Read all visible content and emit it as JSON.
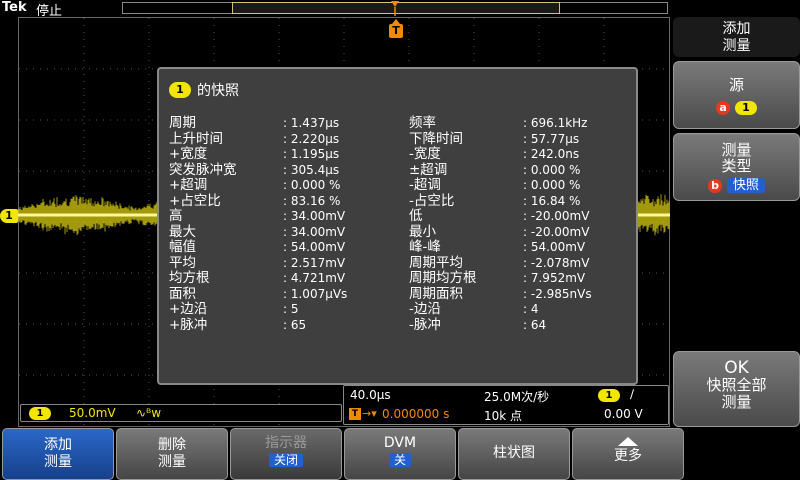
{
  "topbar": {
    "brand": "Tek",
    "status": "停止"
  },
  "markers": {
    "trigger": "T",
    "channel": "1"
  },
  "snapshot": {
    "badge": "1",
    "title": "的快照",
    "left": [
      {
        "label": "周期",
        "value": ": 1.437µs"
      },
      {
        "label": "上升时间",
        "value": ": 2.220µs"
      },
      {
        "label": "+宽度",
        "value": ": 1.195µs"
      },
      {
        "label": "突发脉冲宽",
        "value": ": 305.4µs"
      },
      {
        "label": "+超调",
        "value": ": 0.000 %"
      },
      {
        "label": "+占空比",
        "value": ": 83.16 %"
      },
      {
        "label": "高",
        "value": ": 34.00mV"
      },
      {
        "label": "最大",
        "value": ": 34.00mV"
      },
      {
        "label": "幅值",
        "value": ": 54.00mV"
      },
      {
        "label": "平均",
        "value": ": 2.517mV"
      },
      {
        "label": "均方根",
        "value": ": 4.721mV"
      },
      {
        "label": "面积",
        "value": ": 1.007µVs"
      },
      {
        "label": "+边沿",
        "value": ": 5"
      },
      {
        "label": "+脉冲",
        "value": ": 65"
      }
    ],
    "right": [
      {
        "label": "频率",
        "value": ": 696.1kHz"
      },
      {
        "label": "下降时间",
        "value": ": 57.77µs"
      },
      {
        "label": "-宽度",
        "value": ": 242.0ns"
      },
      {
        "label": "±超调",
        "value": ": 0.000 %"
      },
      {
        "label": "-超调",
        "value": ": 0.000 %"
      },
      {
        "label": "-占空比",
        "value": ": 16.84 %"
      },
      {
        "label": "低",
        "value": ": -20.00mV"
      },
      {
        "label": "最小",
        "value": ": -20.00mV"
      },
      {
        "label": "峰-峰",
        "value": ": 54.00mV"
      },
      {
        "label": "周期平均",
        "value": ": -2.078mV"
      },
      {
        "label": "周期均方根",
        "value": ": 7.952mV"
      },
      {
        "label": "周期面积",
        "value": ": -2.985nVs"
      },
      {
        "label": "-边沿",
        "value": ": 4"
      },
      {
        "label": "-脉冲",
        "value": ": 64"
      }
    ]
  },
  "channel_readout": {
    "badge": "1",
    "scale": "50.0mV",
    "coupling": "∿ᴮw"
  },
  "horizontal": {
    "scale": "40.0µs",
    "sample_rate": "25.0M次/秒",
    "trig_icon": "T",
    "arrow": "→▾",
    "delay": "0.000000 s",
    "record_length": "10k 点",
    "trig_channel": "1",
    "trig_slope": "∕",
    "trig_level": "0.00 V"
  },
  "side_menu": {
    "title_line1": "添加",
    "title_line2": "测量",
    "source_label": "源",
    "source_letter": "a",
    "source_channel": "1",
    "type_line1": "测量",
    "type_line2": "类型",
    "type_letter": "b",
    "type_value": "快照",
    "ok_line1": "OK",
    "ok_line2": "快照全部",
    "ok_line3": "测量"
  },
  "bottom_menu": {
    "add_line1": "添加",
    "add_line2": "测量",
    "delete_line1": "删除",
    "delete_line2": "测量",
    "indicator_label": "指示器",
    "indicator_value": "关闭",
    "dvm_label": "DVM",
    "dvm_value": "关",
    "histogram_label": "柱状图",
    "more_label": "更多"
  },
  "colors": {
    "ch1": "#f2e600",
    "trigger": "#f08a00",
    "highlight": "#2060d0",
    "menu_active": "#16408a"
  }
}
